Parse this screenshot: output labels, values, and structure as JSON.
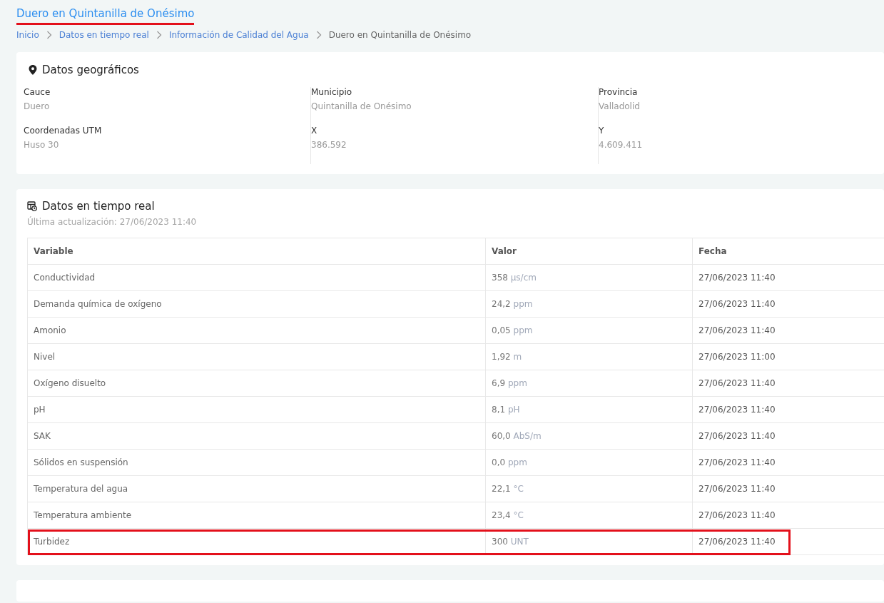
{
  "page_title": {
    "text": "Duero en Quintanilla de Onésimo",
    "underlined": true
  },
  "breadcrumb": [
    {
      "label": "Inicio",
      "link": true
    },
    {
      "label": "Datos en tiempo real",
      "link": true
    },
    {
      "label": "Información de Calidad del Agua",
      "link": true
    },
    {
      "label": "Duero en Quintanilla de Onésimo",
      "link": false
    }
  ],
  "geo": {
    "title": "Datos geográficos",
    "fields": [
      {
        "label": "Cauce",
        "value": "Duero"
      },
      {
        "label": "Municipio",
        "value": "Quintanilla de Onésimo"
      },
      {
        "label": "Provincia",
        "value": "Valladolid"
      },
      {
        "label": "Coordenadas UTM",
        "value": "Huso 30"
      },
      {
        "label": "X",
        "value": "386.592"
      },
      {
        "label": "Y",
        "value": "4.609.411"
      }
    ]
  },
  "realtime": {
    "title": "Datos en tiempo real",
    "updated": "Última actualización: 27/06/2023 11:40",
    "table": {
      "columns": [
        "Variable",
        "Valor",
        "Fecha"
      ],
      "rows": [
        {
          "variable": "Conductividad",
          "amount": "358",
          "unit": "µs/cm",
          "date": "27/06/2023 11:40",
          "highlighted": false
        },
        {
          "variable": "Demanda química de oxígeno",
          "amount": "24,2",
          "unit": "ppm",
          "date": "27/06/2023 11:40",
          "highlighted": false
        },
        {
          "variable": "Amonio",
          "amount": "0,05",
          "unit": "ppm",
          "date": "27/06/2023 11:40",
          "highlighted": false
        },
        {
          "variable": "Nivel",
          "amount": "1,92",
          "unit": "m",
          "date": "27/06/2023 11:00",
          "highlighted": false
        },
        {
          "variable": "Oxígeno disuelto",
          "amount": "6,9",
          "unit": "ppm",
          "date": "27/06/2023 11:40",
          "highlighted": false
        },
        {
          "variable": "pH",
          "amount": "8,1",
          "unit": "pH",
          "date": "27/06/2023 11:40",
          "highlighted": false
        },
        {
          "variable": "SAK",
          "amount": "60,0",
          "unit": "AbS/m",
          "date": "27/06/2023 11:40",
          "highlighted": false
        },
        {
          "variable": "Sólidos en suspensión",
          "amount": "0,0",
          "unit": "ppm",
          "date": "27/06/2023 11:40",
          "highlighted": false
        },
        {
          "variable": "Temperatura del agua",
          "amount": "22,1",
          "unit": "°C",
          "date": "27/06/2023 11:40",
          "highlighted": false
        },
        {
          "variable": "Temperatura ambiente",
          "amount": "23,4",
          "unit": "°C",
          "date": "27/06/2023 11:40",
          "highlighted": false
        },
        {
          "variable": "Turbidez",
          "amount": "300",
          "unit": "UNT",
          "date": "27/06/2023 11:40",
          "highlighted": true
        }
      ]
    }
  }
}
